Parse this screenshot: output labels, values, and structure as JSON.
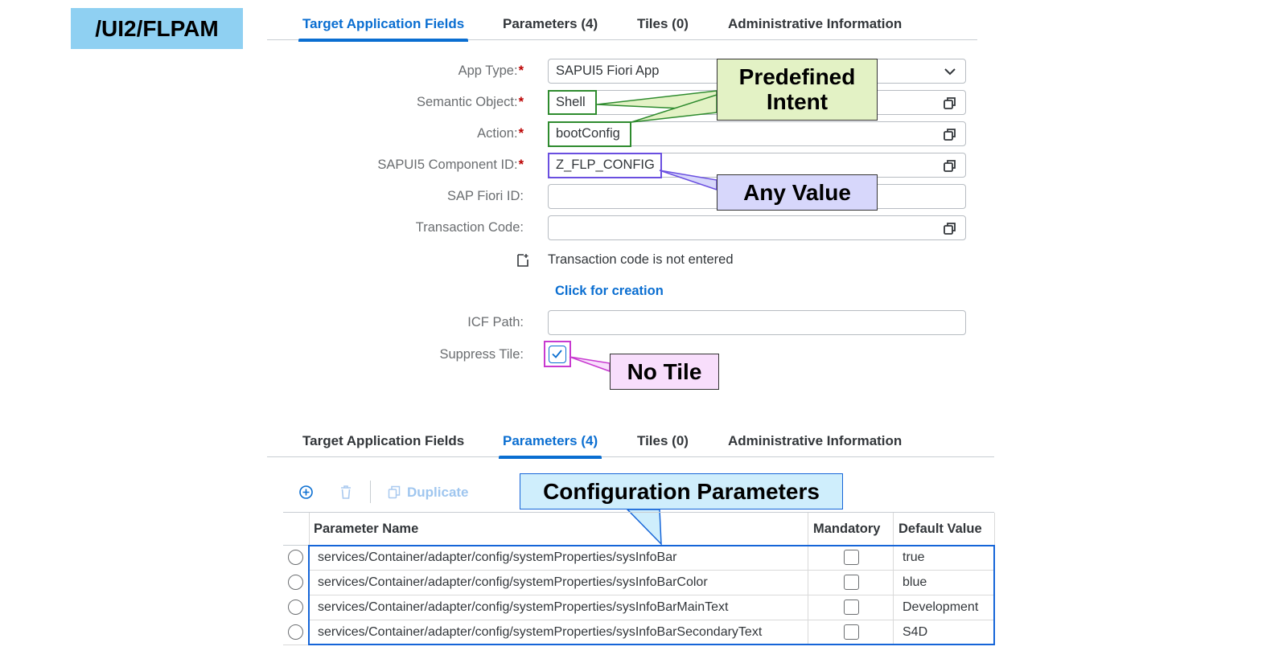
{
  "badge": "/UI2/FLPAM",
  "tabs_top": [
    {
      "label": "Target Application Fields",
      "active": true
    },
    {
      "label": "Parameters (4)",
      "active": false
    },
    {
      "label": "Tiles (0)",
      "active": false
    },
    {
      "label": "Administrative Information",
      "active": false
    }
  ],
  "form": {
    "app_type": {
      "label": "App Type:",
      "value": "SAPUI5 Fiori App"
    },
    "semantic_object": {
      "label": "Semantic Object:",
      "value": "Shell"
    },
    "action": {
      "label": "Action:",
      "value": "bootConfig"
    },
    "component_id": {
      "label": "SAPUI5 Component ID:",
      "value": "Z_FLP_CONFIG"
    },
    "fiori_id": {
      "label": "SAP Fiori ID:",
      "value": ""
    },
    "transaction_code": {
      "label": "Transaction Code:",
      "value": ""
    },
    "tcode_info": "Transaction code is not entered",
    "creation_link": "Click for creation",
    "icf_path": {
      "label": "ICF Path:",
      "value": ""
    },
    "suppress_tile": {
      "label": "Suppress Tile:",
      "checked": true
    },
    "required_mark": "*"
  },
  "callouts": {
    "predefined_intent": "Predefined Intent",
    "any_value": "Any Value",
    "no_tile": "No Tile",
    "config_params": "Configuration Parameters"
  },
  "tabs_bottom": [
    {
      "label": "Target Application Fields",
      "active": false
    },
    {
      "label": "Parameters (4)",
      "active": true
    },
    {
      "label": "Tiles (0)",
      "active": false
    },
    {
      "label": "Administrative Information",
      "active": false
    }
  ],
  "toolbar": {
    "duplicate_label": "Duplicate"
  },
  "table": {
    "headers": {
      "name": "Parameter Name",
      "mandatory": "Mandatory",
      "default": "Default Value"
    },
    "rows": [
      {
        "name": "services/Container/adapter/config/systemProperties/sysInfoBar",
        "mandatory": false,
        "default": "true"
      },
      {
        "name": "services/Container/adapter/config/systemProperties/sysInfoBarColor",
        "mandatory": false,
        "default": "blue"
      },
      {
        "name": "services/Container/adapter/config/systemProperties/sysInfoBarMainText",
        "mandatory": false,
        "default": "Development"
      },
      {
        "name": "services/Container/adapter/config/systemProperties/sysInfoBarSecondaryText",
        "mandatory": false,
        "default": "S4D"
      }
    ]
  },
  "colors": {
    "accent": "#0a6ed1",
    "badge_bg": "#8fd0f2",
    "green_callout_bg": "#e3f2c5",
    "purple_callout_bg": "#d7d7fb",
    "pink_callout_bg": "#f8defc",
    "blue_callout_bg": "#cfeefc",
    "green_outline": "#2e8b2e",
    "purple_outline": "#6a4fe0",
    "magenta_outline": "#c83ad0",
    "blue_outline": "#1565d8"
  }
}
